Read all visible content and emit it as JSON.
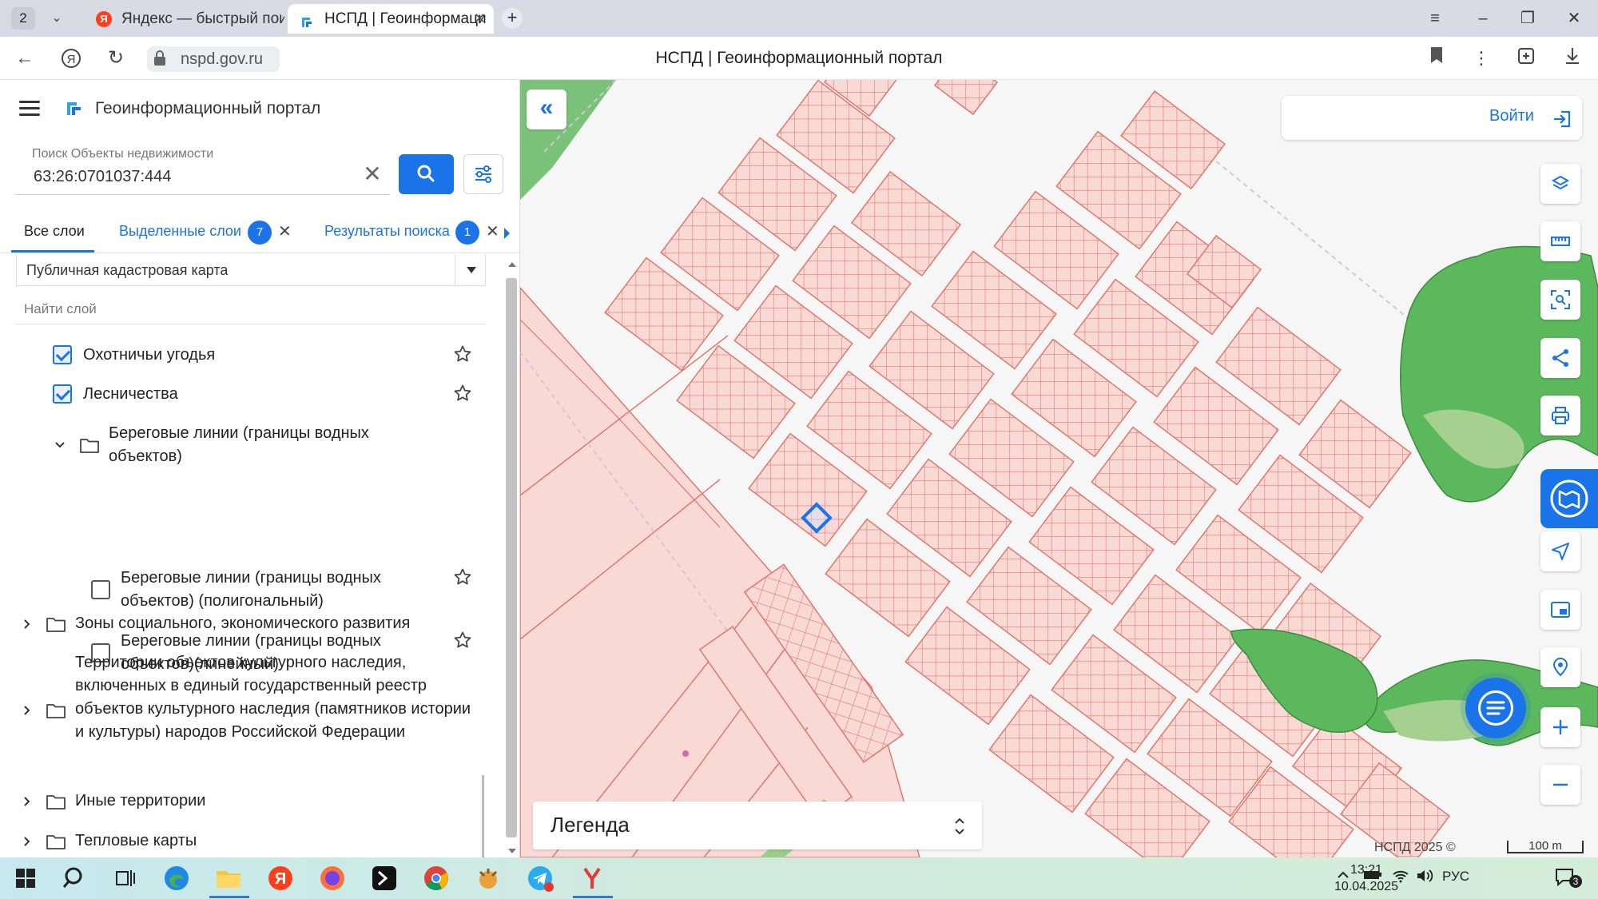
{
  "browser": {
    "tab_count": "2",
    "tabs": [
      {
        "label": "Яндекс — быстрый поиск",
        "active": false
      },
      {
        "label": "НСПД | Геоинформаци",
        "active": true
      }
    ],
    "url": "nspd.gov.ru",
    "page_title": "НСПД | Геоинформационный портал"
  },
  "app": {
    "title": "Геоинформационный портал",
    "search": {
      "label": "Поиск Объекты недвижимости",
      "value": "63:26:0701037:444"
    },
    "tabs": [
      {
        "label": "Все слои",
        "active": true
      },
      {
        "label": "Выделенные слои",
        "badge": "7"
      },
      {
        "label": "Результаты поиска",
        "badge": "1"
      }
    ],
    "base_map": "Публичная кадастровая карта",
    "find_layer_placeholder": "Найти слой",
    "layers": [
      {
        "label": "Охотничьи угодья",
        "checked": true
      },
      {
        "label": "Лесничества",
        "checked": true
      },
      {
        "label": "Береговые линии (границы водных объектов)"
      },
      {
        "label": "Береговые линии (границы водных объектов) (полигональный)",
        "checked": false
      },
      {
        "label": "Береговые линии (границы водных объектов)(линейный)",
        "checked": false
      },
      {
        "label": "Зоны социального, экономического развития"
      },
      {
        "label": "Территории объектов культурного наследия, включенных в единый государственный реестр объектов культурного наследия (памятников истории и культуры) народов Российской Федерации"
      },
      {
        "label": "Иные территории"
      },
      {
        "label": "Тепловые карты"
      }
    ]
  },
  "map": {
    "login_label": "Войти",
    "legend_label": "Легенда",
    "copyright": "НСПД 2025 ©",
    "scale": "100 m",
    "colors": {
      "parcel_fill": "#f8d9d6",
      "parcel_stroke": "#e0786a",
      "forest": "#5cb85c",
      "highlight": "#1a73e8"
    }
  },
  "taskbar": {
    "lang": "РУС",
    "time": "13:21",
    "date": "10.04.2025",
    "notifications": "3"
  }
}
